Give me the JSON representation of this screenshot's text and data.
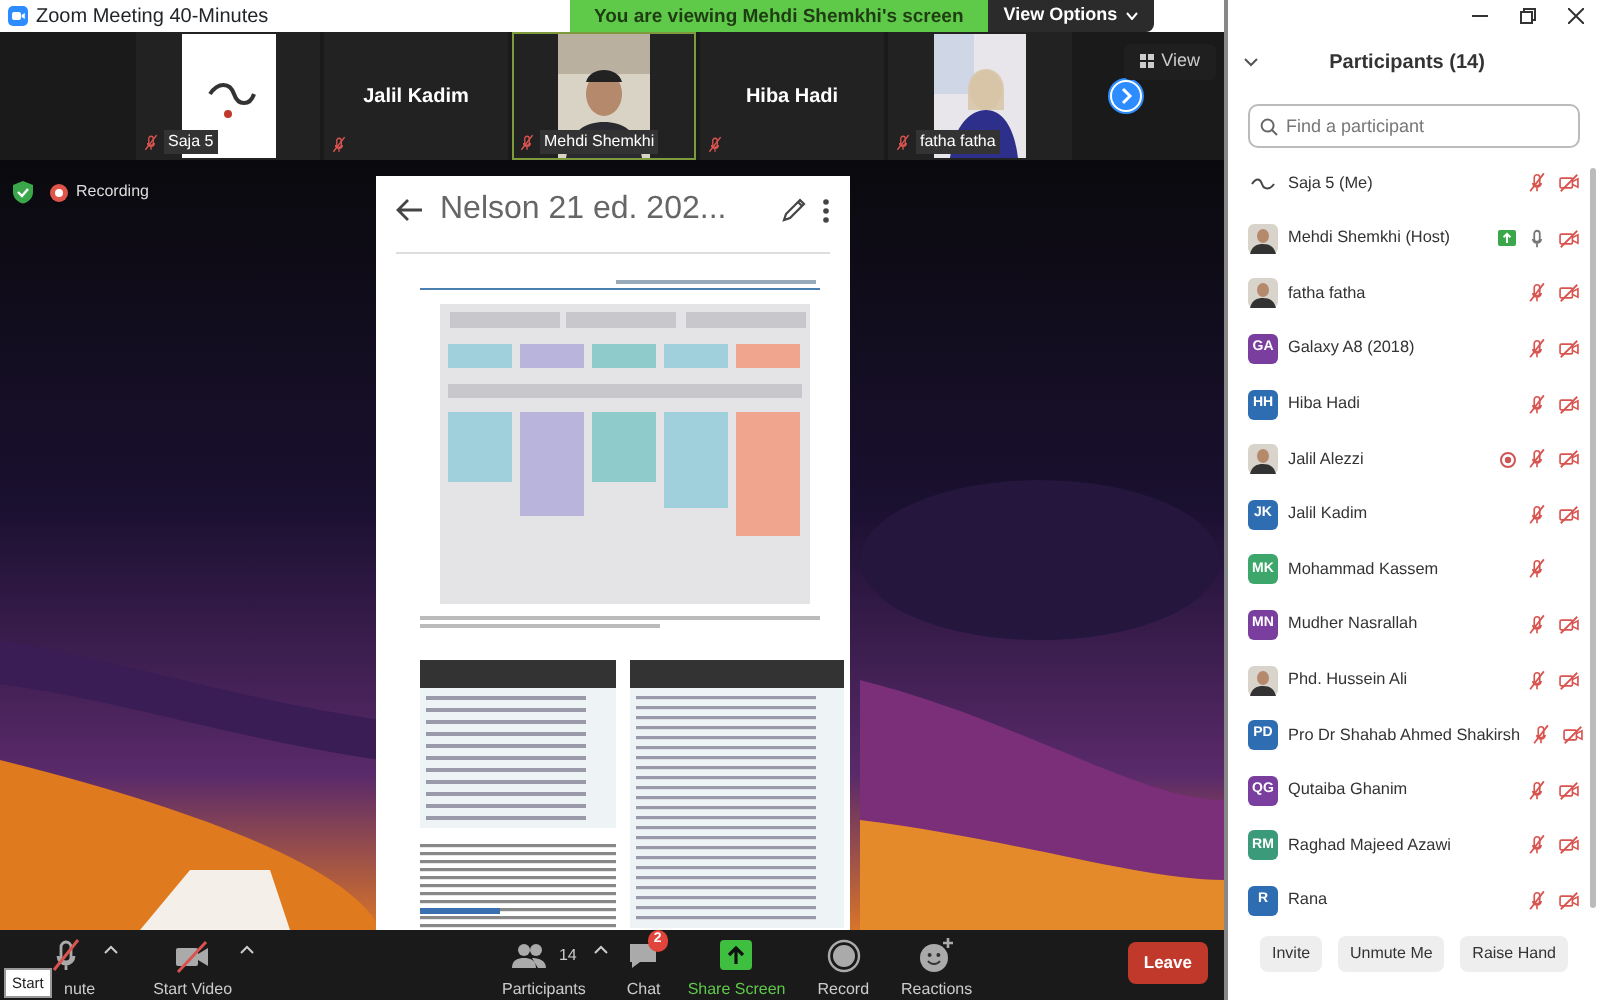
{
  "window": {
    "title": "Zoom Meeting 40-Minutes"
  },
  "share_banner": {
    "text": "You are viewing Mehdi Shemkhi's screen",
    "view_options": "View Options"
  },
  "video_strip": {
    "view_label": "View",
    "tiles": [
      {
        "name": "Saja 5",
        "kind": "logo",
        "highlighted": false
      },
      {
        "name": "Jalil Kadim",
        "kind": "name",
        "highlighted": false
      },
      {
        "name": "Mehdi Shemkhi",
        "highlighted": true
      },
      {
        "name": "Hiba Hadi",
        "kind": "name",
        "highlighted": false
      },
      {
        "name": "fatha fatha",
        "highlighted": false
      }
    ]
  },
  "recording": {
    "label": "Recording"
  },
  "document": {
    "title": "Nelson 21 ed. 202..."
  },
  "toolbar": {
    "tooltip": "Start",
    "leave": "Leave",
    "items": [
      {
        "kind": "mic",
        "label": "nute",
        "caret": true
      },
      {
        "kind": "video",
        "label": "Start Video",
        "caret": true
      },
      {
        "kind": "participants",
        "label": "Participants",
        "count": "14",
        "caret": true
      },
      {
        "kind": "chat",
        "label": "Chat",
        "badge": "2",
        "caret": false
      },
      {
        "kind": "share",
        "label": "Share Screen",
        "caret": false
      },
      {
        "kind": "record",
        "label": "Record",
        "caret": false
      },
      {
        "kind": "reactions",
        "label": "Reactions",
        "caret": false
      }
    ]
  },
  "participants_panel": {
    "title": "Participants (14)",
    "search": {
      "placeholder": "Find a participant"
    },
    "participants": [
      {
        "name": "Saja 5 (Me)",
        "avatar": {
          "kind": "logo"
        },
        "muted": true,
        "video_icon": true,
        "sharing": false,
        "recording": false
      },
      {
        "name": "Mehdi Shemkhi (Host)",
        "muted": false,
        "video_icon": true,
        "sharing": true,
        "recording": false
      },
      {
        "name": "fatha fatha",
        "muted": true,
        "video_icon": true,
        "sharing": false,
        "recording": false
      },
      {
        "name": "Galaxy A8 (2018)",
        "avatar": {
          "kind": "initials",
          "text": "GA",
          "color": "#7a3f9e"
        },
        "muted": true,
        "video_icon": true,
        "sharing": false,
        "recording": false
      },
      {
        "name": "Hiba Hadi",
        "avatar": {
          "kind": "initials",
          "text": "HH",
          "color": "#2f6db3"
        },
        "muted": true,
        "video_icon": true,
        "sharing": false,
        "recording": false
      },
      {
        "name": "Jalil Alezzi",
        "muted": true,
        "video_icon": true,
        "sharing": false,
        "recording": true
      },
      {
        "name": "Jalil Kadim",
        "avatar": {
          "kind": "initials",
          "text": "JK",
          "color": "#2f6db3"
        },
        "muted": true,
        "video_icon": true,
        "sharing": false,
        "recording": false
      },
      {
        "name": "Mohammad Kassem",
        "avatar": {
          "kind": "initials",
          "text": "MK",
          "color": "#3da66a"
        },
        "muted": true,
        "video_icon": false,
        "sharing": false,
        "recording": false
      },
      {
        "name": "Mudher Nasrallah",
        "avatar": {
          "kind": "initials",
          "text": "MN",
          "color": "#7a3f9e"
        },
        "muted": true,
        "video_icon": true,
        "sharing": false,
        "recording": false
      },
      {
        "name": "Phd. Hussein Ali",
        "muted": true,
        "video_icon": true,
        "sharing": false,
        "recording": false
      },
      {
        "name": "Pro Dr Shahab Ahmed Shakirsh",
        "avatar": {
          "kind": "initials",
          "text": "PD",
          "color": "#2f6db3"
        },
        "muted": true,
        "video_icon": true,
        "sharing": false,
        "recording": false
      },
      {
        "name": "Qutaiba Ghanim",
        "avatar": {
          "kind": "initials",
          "text": "QG",
          "color": "#7a3f9e"
        },
        "muted": true,
        "video_icon": true,
        "sharing": false,
        "recording": false
      },
      {
        "name": "Raghad Majeed Azawi",
        "avatar": {
          "kind": "initials",
          "text": "RM",
          "color": "#3a9a7a"
        },
        "muted": true,
        "video_icon": true,
        "sharing": false,
        "recording": false
      },
      {
        "name": "Rana",
        "avatar": {
          "kind": "initials",
          "text": "R",
          "color": "#2f6db3"
        },
        "muted": true,
        "video_icon": true,
        "sharing": false,
        "recording": false
      }
    ],
    "buttons": [
      "Invite",
      "Unmute Me",
      "Raise Hand"
    ]
  }
}
